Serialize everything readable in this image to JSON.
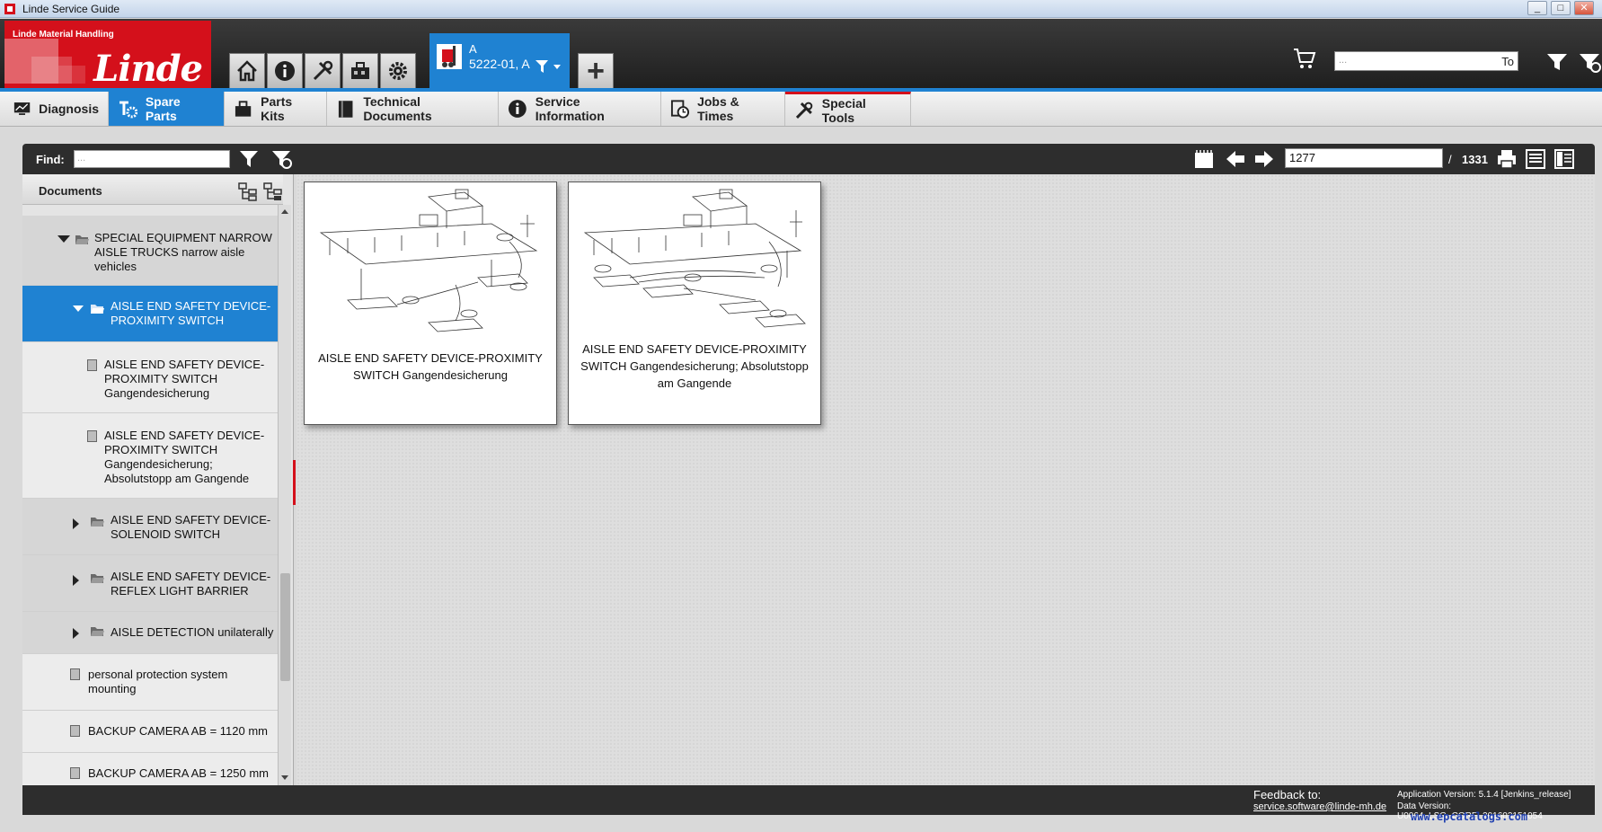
{
  "window": {
    "title": "Linde Service Guide",
    "minimize": "_",
    "maximize": "□",
    "close": "✕"
  },
  "header": {
    "logo_small": "Linde Material Handling",
    "logo_brand": "Linde",
    "vehicle_line1": "A",
    "vehicle_line2": "5222-01, A",
    "add_button": "+",
    "search_placeholder": "...",
    "search_scope": "To",
    "icons": [
      "home-icon",
      "info-icon",
      "tools-icon",
      "parts-kit-icon",
      "gear-icon",
      "forklift-icon",
      "filter-dropdown-icon",
      "cart-icon",
      "filter-icon",
      "filter-clear-icon"
    ]
  },
  "nav": {
    "tabs": [
      {
        "label": "Diagnosis",
        "icon": "monitor-icon"
      },
      {
        "label": "Spare Parts",
        "icon": "spare-parts-icon"
      },
      {
        "label": "Parts Kits",
        "icon": "parts-kit-icon"
      },
      {
        "label": "Technical Documents",
        "icon": "book-icon"
      },
      {
        "label": "Service Information",
        "icon": "info-icon"
      },
      {
        "label": "Jobs & Times",
        "icon": "clock-doc-icon"
      },
      {
        "label": "Special Tools",
        "icon": "tools-icon"
      }
    ],
    "active_tab": "Spare Parts"
  },
  "toolbar": {
    "find_label": "Find:",
    "find_placeholder": "...",
    "page_current": "1277",
    "page_separator": "/",
    "page_total": "1331"
  },
  "documents": {
    "header": "Documents",
    "items": [
      {
        "text1": "SPECIAL EQUIPMENT NARROW",
        "text2": "AISLE TRUCKS narrow aisle",
        "text3": "vehicles"
      },
      {
        "text1": "AISLE END SAFETY DEVICE-",
        "text2": "PROXIMITY SWITCH"
      },
      {
        "text1": "AISLE END SAFETY DEVICE-",
        "text2": "PROXIMITY SWITCH",
        "text3": "Gangendesicherung"
      },
      {
        "text1": "AISLE END SAFETY DEVICE-",
        "text2": "PROXIMITY SWITCH",
        "text3": "Gangendesicherung;",
        "text4": "Absolutstopp am Gangende"
      },
      {
        "text1": "AISLE END SAFETY DEVICE-",
        "text2": "SOLENOID SWITCH"
      },
      {
        "text1": "AISLE END SAFETY DEVICE-",
        "text2": "REFLEX LIGHT BARRIER"
      },
      {
        "text1": "AISLE DETECTION unilaterally"
      },
      {
        "text1": "personal protection system",
        "text2": "mounting"
      },
      {
        "text1": "BACKUP CAMERA AB = 1120 mm"
      },
      {
        "text1": "BACKUP CAMERA AB = 1250 mm"
      }
    ]
  },
  "cards": [
    {
      "line1": "AISLE END SAFETY DEVICE-PROXIMITY",
      "line2": "SWITCH Gangendesicherung"
    },
    {
      "line1": "AISLE END SAFETY DEVICE-PROXIMITY",
      "line2": "SWITCH Gangendesicherung; Absolutstopp",
      "line3": "am Gangende"
    }
  ],
  "footer": {
    "feedback_label": "Feedback to:",
    "feedback_email": "service.software@linde-mh.de",
    "app_version": "Application Version: 5.1.4 [Jenkins_release]",
    "data_version": "Data Version: U0064_LSG_CORE_201603151054"
  },
  "watermark": "www.epcatalogs.com",
  "colors": {
    "accent": "#1f82d2",
    "brand_red": "#d4101b",
    "dark_bar": "#2d2d2d"
  }
}
